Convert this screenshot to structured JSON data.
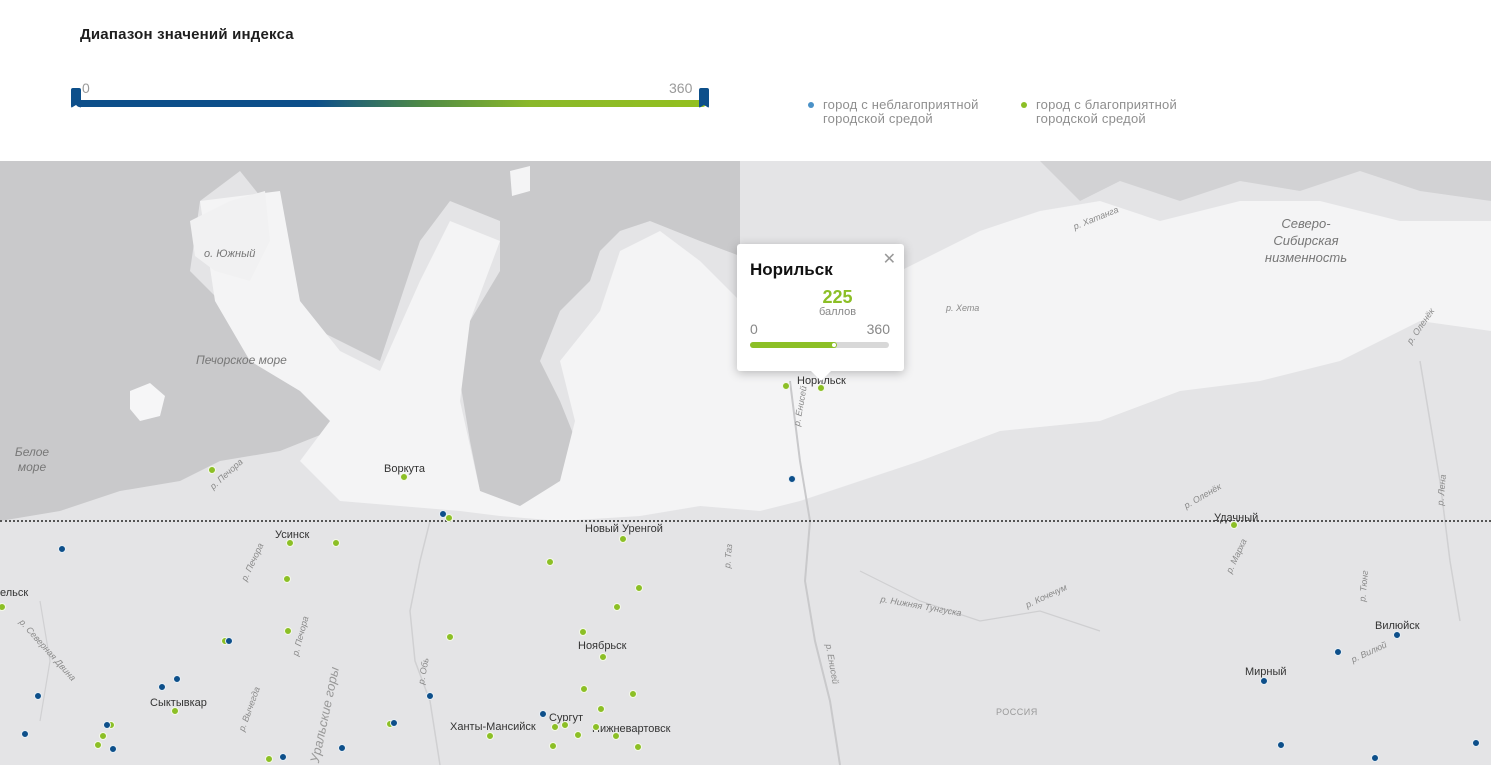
{
  "range": {
    "title": "Диапазон значений индекса",
    "min": "0",
    "max": "360"
  },
  "legend": {
    "bad": "город с неблагоприятной городской средой",
    "good": "город с благоприятной городской средой",
    "colors": {
      "bad": "#0d4f8a",
      "good": "#8cbf26"
    }
  },
  "popup": {
    "city": "Норильск",
    "score": "225",
    "unit": "баллов",
    "min": "0",
    "max": "360",
    "value": 225,
    "scale_max": 360,
    "close_icon": "close-icon"
  },
  "seas": {
    "pechora": "Печорское море",
    "white": "Белое море"
  },
  "islands": {
    "yuzhny": "о. Южный"
  },
  "regions": {
    "siberian_lowland": "Северо-Сибирская низменность",
    "urals": "Уральские горы",
    "russia": "РОССИЯ"
  },
  "rivers": [
    "р. Хатанга",
    "р. Хета",
    "р. Оленёк",
    "р. Оленёк",
    "р. Енисей",
    "р. Енисей",
    "р. Таз",
    "р. Нижняя Тунгуска",
    "р. Кочечум",
    "р. Марха",
    "р. Тюнг",
    "р. Вилюй",
    "р. Лена",
    "р. Печора",
    "р. Печора",
    "р. Обь",
    "р. Вычегда",
    "р. Северная Двина",
    "р. Печора"
  ],
  "cities": [
    "Норильск",
    "Воркута",
    "Усинск",
    "Новый Уренгой",
    "Удачный",
    "Ноябрьск",
    "Сыктывкар",
    "Ханты-Мансийск",
    "Сургут",
    "Нижневартовск",
    "Вилюйск",
    "Мирный",
    "ельск"
  ]
}
